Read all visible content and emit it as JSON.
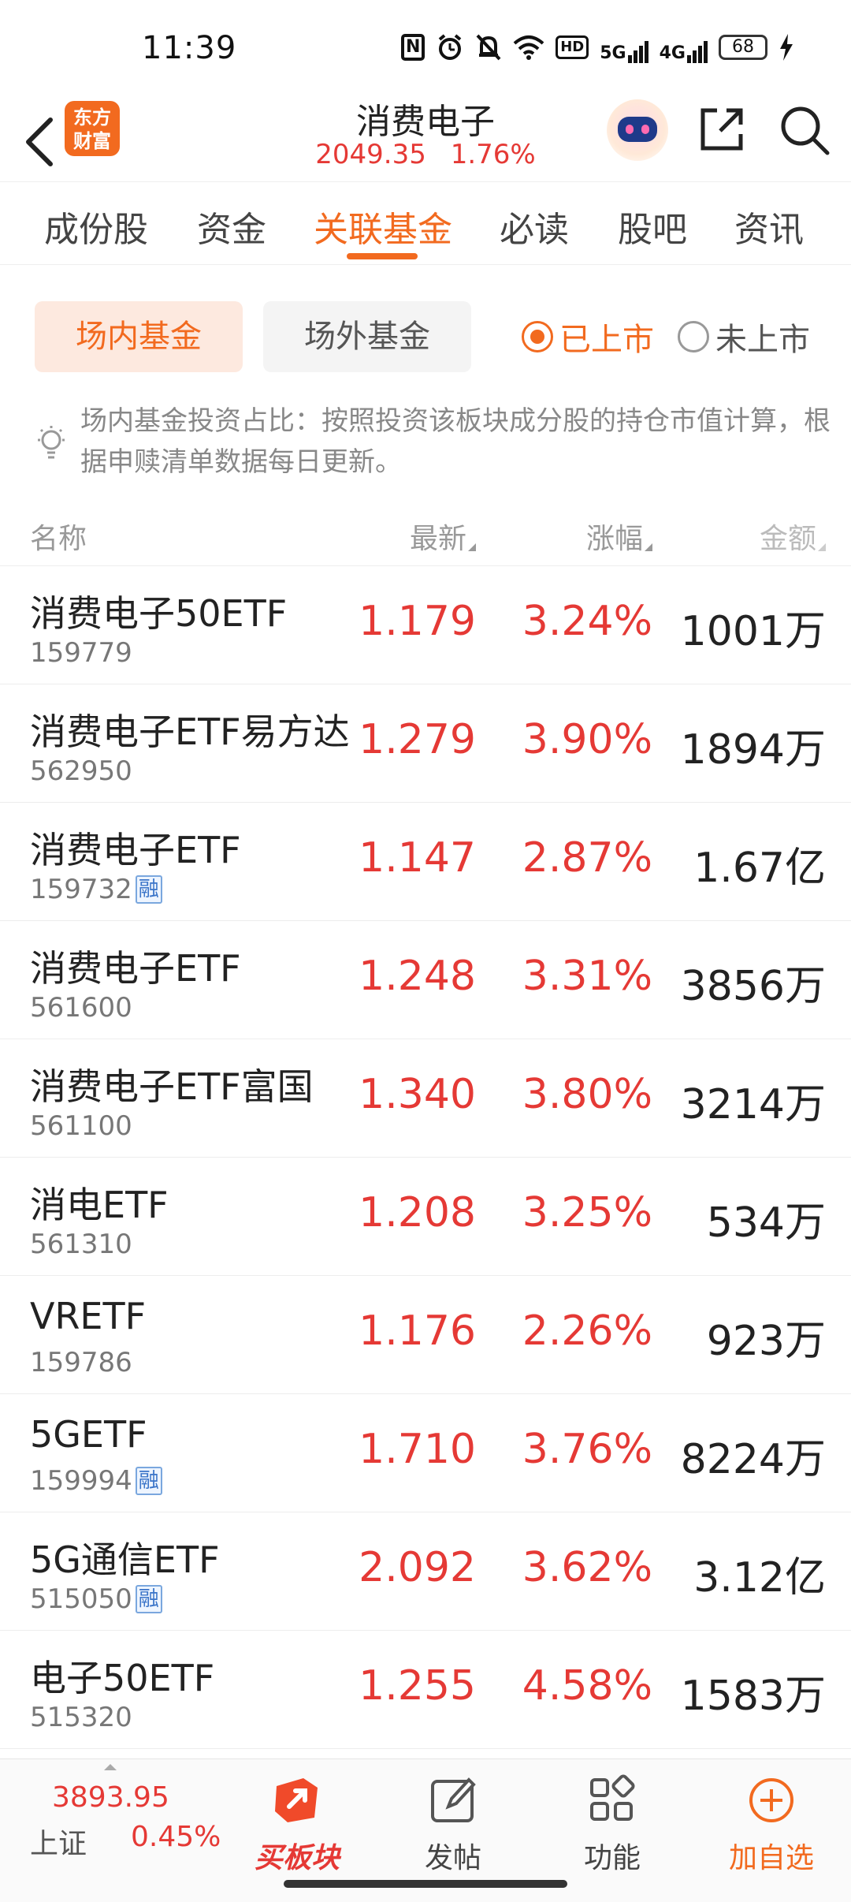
{
  "status_bar": {
    "time": "11:39",
    "nfc": "N",
    "hd": "HD",
    "signal1": "5G",
    "signal2": "4G",
    "battery": "68"
  },
  "header": {
    "logo_text": "东方\n财富",
    "title": "消费电子",
    "index_value": "2049.35",
    "index_change": "1.76%"
  },
  "tabs": [
    {
      "label": "成份股"
    },
    {
      "label": "资金"
    },
    {
      "label": "关联基金"
    },
    {
      "label": "必读"
    },
    {
      "label": "股吧"
    },
    {
      "label": "资讯"
    }
  ],
  "filters": {
    "in_market": "场内基金",
    "off_market": "场外基金",
    "listed": "已上市",
    "unlisted": "未上市"
  },
  "note": "场内基金投资占比：按照投资该板块成分股的持仓市值计算，根据申赎清单数据每日更新。",
  "table": {
    "columns": [
      "名称",
      "最新",
      "涨幅",
      "金额"
    ],
    "rows": [
      {
        "name": "消费电子50ETF",
        "code": "159779",
        "badge": "",
        "price": "1.179",
        "change": "3.24%",
        "amount": "1001万"
      },
      {
        "name": "消费电子ETF易方达",
        "code": "562950",
        "badge": "",
        "price": "1.279",
        "change": "3.90%",
        "amount": "1894万"
      },
      {
        "name": "消费电子ETF",
        "code": "159732",
        "badge": "融",
        "price": "1.147",
        "change": "2.87%",
        "amount": "1.67亿"
      },
      {
        "name": "消费电子ETF",
        "code": "561600",
        "badge": "",
        "price": "1.248",
        "change": "3.31%",
        "amount": "3856万"
      },
      {
        "name": "消费电子ETF富国",
        "code": "561100",
        "badge": "",
        "price": "1.340",
        "change": "3.80%",
        "amount": "3214万"
      },
      {
        "name": "消电ETF",
        "code": "561310",
        "badge": "",
        "price": "1.208",
        "change": "3.25%",
        "amount": "534万"
      },
      {
        "name": "VRETF",
        "code": "159786",
        "badge": "",
        "price": "1.176",
        "change": "2.26%",
        "amount": "923万"
      },
      {
        "name": "5GETF",
        "code": "159994",
        "badge": "融",
        "price": "1.710",
        "change": "3.76%",
        "amount": "8224万"
      },
      {
        "name": "5G通信ETF",
        "code": "515050",
        "badge": "融",
        "price": "2.092",
        "change": "3.62%",
        "amount": "3.12亿"
      },
      {
        "name": "电子50ETF",
        "code": "515320",
        "badge": "",
        "price": "1.255",
        "change": "4.58%",
        "amount": "1583万"
      }
    ]
  },
  "bottom_bar": {
    "index_value": "3893.95",
    "index_name": "上证",
    "index_change": "0.45%",
    "nav": [
      {
        "label": "买板块",
        "icon": "buy-sector-icon"
      },
      {
        "label": "发帖",
        "icon": "edit-post-icon"
      },
      {
        "label": "功能",
        "icon": "grid-apps-icon"
      },
      {
        "label": "加自选",
        "icon": "plus-circle-icon"
      }
    ]
  },
  "colors": {
    "accent": "#f26a1f",
    "up_red": "#e53935"
  }
}
